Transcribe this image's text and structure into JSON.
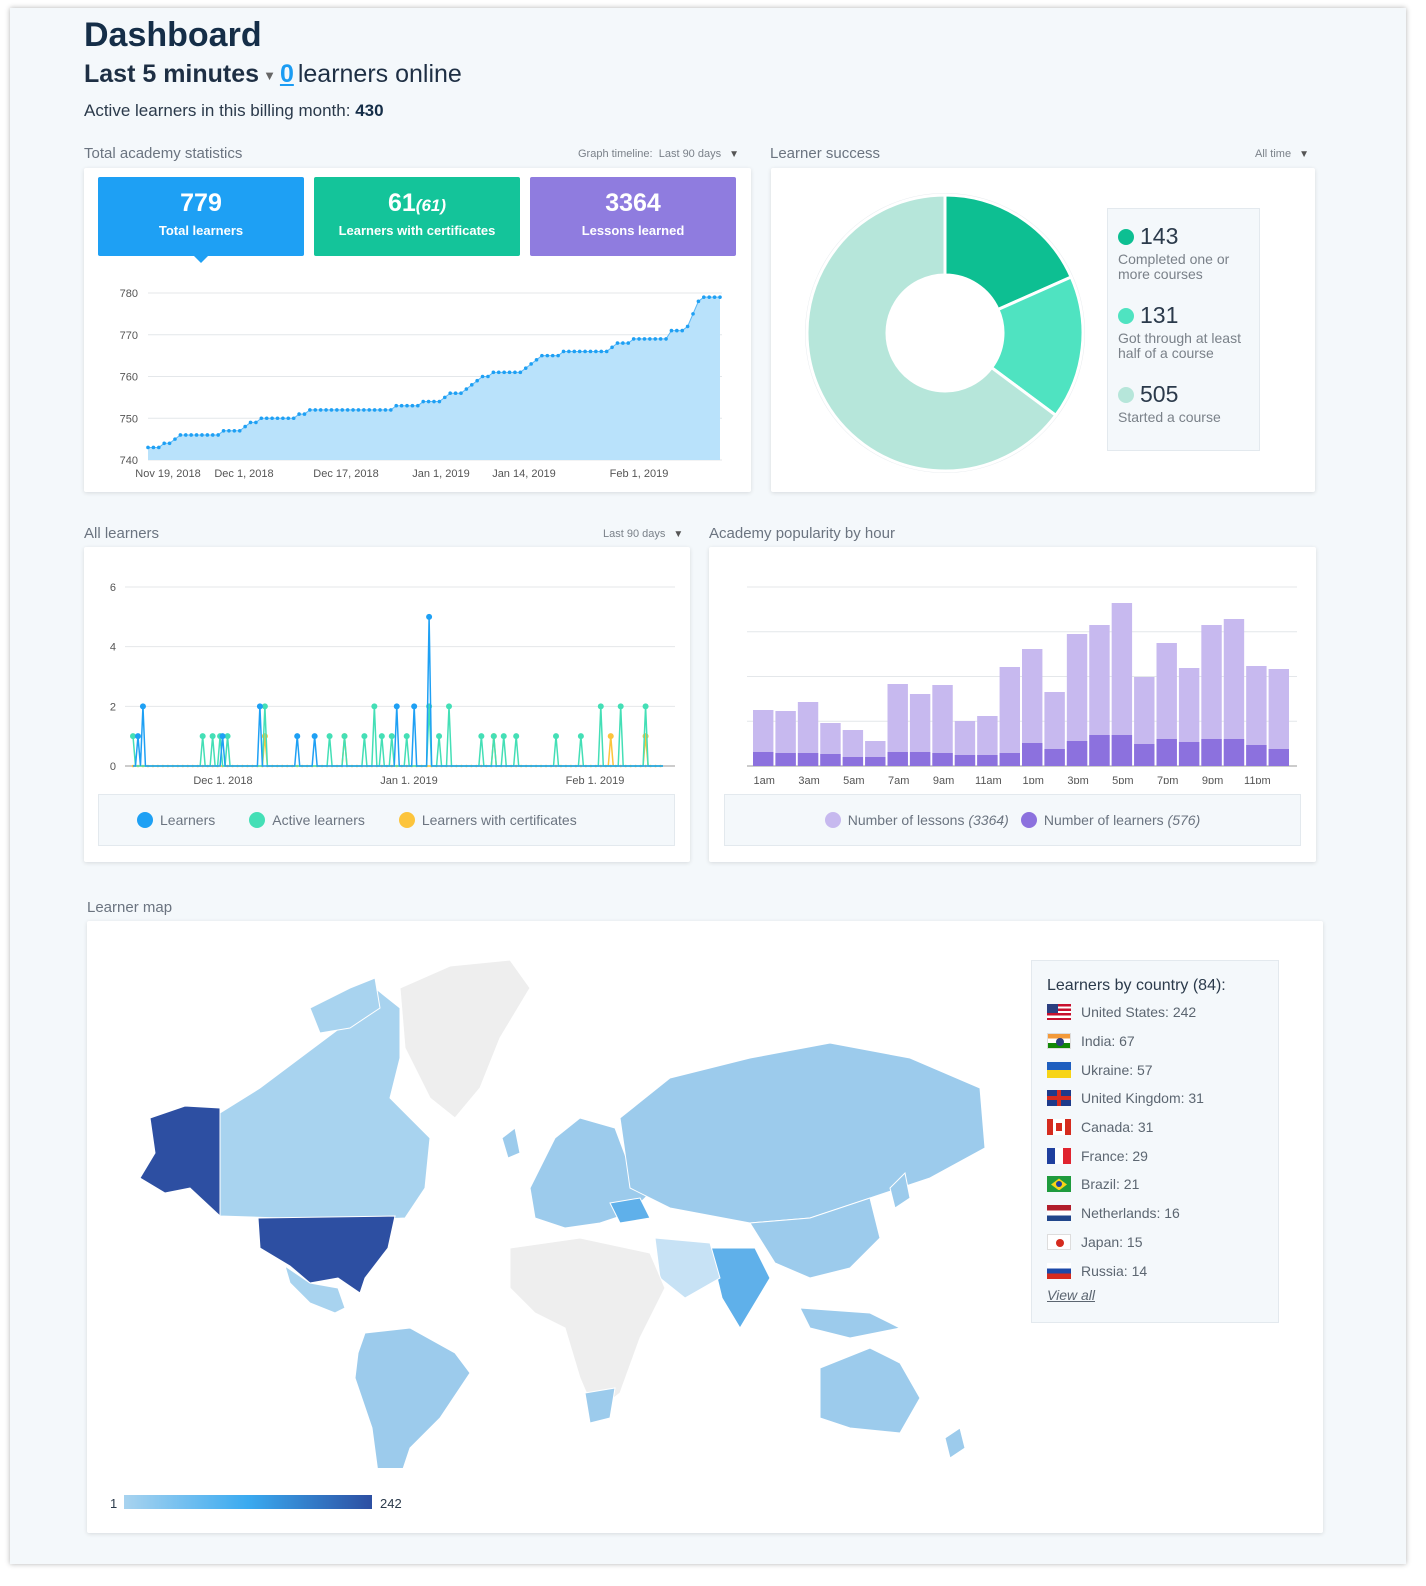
{
  "header": {
    "title": "Dashboard",
    "period_label": "Last 5 minutes",
    "online_count": "0",
    "online_suffix": "learners online",
    "billing_label": "Active learners in this billing month:",
    "billing_value": "430"
  },
  "stats": {
    "section_label": "Total academy statistics",
    "timeline_label": "Graph timeline:",
    "timeline_value": "Last 90 days",
    "total_learners": {
      "value": "779",
      "label": "Total learners",
      "color": "#1ea0f4"
    },
    "certificates": {
      "value": "61",
      "value_paren": "(61)",
      "label": "Learners with certificates",
      "color": "#14c49a"
    },
    "lessons": {
      "value": "3364",
      "label": "Lessons learned",
      "color": "#8f7cdf"
    }
  },
  "success": {
    "section_label": "Learner success",
    "filter": "All time",
    "items": [
      {
        "value": "143",
        "label": "Completed one or more courses",
        "color": "#0dbf92"
      },
      {
        "value": "131",
        "label": "Got through at least half of a course",
        "color": "#4fe3c1"
      },
      {
        "value": "505",
        "label": "Started a course",
        "color": "#b6e6da"
      }
    ]
  },
  "all_learners": {
    "section_label": "All learners",
    "filter": "Last 90 days",
    "legend": [
      {
        "label": "Learners",
        "color": "#1ea0f4"
      },
      {
        "label": "Active learners",
        "color": "#44dfb6"
      },
      {
        "label": "Learners with certificates",
        "color": "#fcc43c"
      }
    ]
  },
  "popularity": {
    "section_label": "Academy popularity by hour",
    "legend": {
      "lessons_label": "Number of lessons",
      "lessons_total": "(3364)",
      "learners_label": "Number of learners",
      "learners_total": "(576)",
      "lessons_color": "#c7b9ef",
      "learners_color": "#8c71de"
    }
  },
  "map": {
    "section_label": "Learner map",
    "scale_min": "1",
    "scale_max": "242",
    "country_title": "Learners by country (84):",
    "countries": [
      {
        "name": "United States: 242",
        "flag": "us-flag-icon"
      },
      {
        "name": "India: 67",
        "flag": "in-flag-icon"
      },
      {
        "name": "Ukraine: 57",
        "flag": "ua-flag-icon"
      },
      {
        "name": "United Kingdom: 31",
        "flag": "gb-flag-icon"
      },
      {
        "name": "Canada: 31",
        "flag": "ca-flag-icon"
      },
      {
        "name": "France: 29",
        "flag": "fr-flag-icon"
      },
      {
        "name": "Brazil: 21",
        "flag": "br-flag-icon"
      },
      {
        "name": "Netherlands: 16",
        "flag": "nl-flag-icon"
      },
      {
        "name": "Japan: 15",
        "flag": "jp-flag-icon"
      },
      {
        "name": "Russia: 14",
        "flag": "ru-flag-icon"
      }
    ],
    "view_all": "View all"
  },
  "chart_data": [
    {
      "type": "area",
      "title": "Total learners",
      "x": [
        "Nov 19, 2018",
        "Dec 1, 2018",
        "Dec 17, 2018",
        "Jan 1, 2019",
        "Jan 14, 2019",
        "Feb 1, 2019"
      ],
      "yticks": [
        "740",
        "750",
        "760",
        "770",
        "780"
      ],
      "ylim": [
        740,
        780
      ],
      "values": [
        743,
        743,
        743,
        744,
        744,
        745,
        746,
        746,
        746,
        746,
        746,
        746,
        746,
        746,
        747,
        747,
        747,
        747,
        748,
        749,
        749,
        750,
        750,
        750,
        750,
        750,
        750,
        750,
        751,
        751,
        752,
        752,
        752,
        752,
        752,
        752,
        752,
        752,
        752,
        752,
        752,
        752,
        752,
        752,
        752,
        752,
        753,
        753,
        753,
        753,
        753,
        754,
        754,
        754,
        754,
        755,
        756,
        756,
        756,
        757,
        758,
        759,
        760,
        760,
        761,
        761,
        761,
        761,
        761,
        761,
        762,
        763,
        764,
        765,
        765,
        765,
        765,
        766,
        766,
        766,
        766,
        766,
        766,
        766,
        766,
        766,
        767,
        768,
        768,
        768,
        769,
        769,
        769,
        769,
        769,
        769,
        769,
        771,
        771,
        771,
        772,
        775,
        778,
        779,
        779,
        779,
        779
      ]
    },
    {
      "type": "line",
      "title": "All learners",
      "x": [
        "Dec 1, 2018",
        "Jan 1, 2019",
        "Feb 1, 2019"
      ],
      "yticks": [
        "0",
        "2",
        "4",
        "6"
      ],
      "ylim": [
        0,
        6
      ],
      "series": [
        {
          "name": "Learners",
          "peaks": [
            [
              2,
              1
            ],
            [
              4,
              2
            ],
            [
              36,
              1
            ],
            [
              51,
              2
            ],
            [
              66,
              1
            ],
            [
              73,
              1
            ],
            [
              106,
              2
            ],
            [
              113,
              2
            ],
            [
              119,
              5
            ]
          ]
        },
        {
          "name": "Active learners",
          "peaks": [
            [
              0,
              1
            ],
            [
              28,
              1
            ],
            [
              32,
              1
            ],
            [
              35,
              1
            ],
            [
              38,
              1
            ],
            [
              53,
              2
            ],
            [
              79,
              1
            ],
            [
              85,
              1
            ],
            [
              93,
              1
            ],
            [
              97,
              2
            ],
            [
              100,
              1
            ],
            [
              104,
              1
            ],
            [
              110,
              1
            ],
            [
              119,
              2
            ],
            [
              123,
              1
            ],
            [
              127,
              2
            ],
            [
              140,
              1
            ],
            [
              145,
              1
            ],
            [
              149,
              1
            ],
            [
              154,
              1
            ],
            [
              170,
              1
            ],
            [
              180,
              1
            ],
            [
              188,
              2
            ],
            [
              196,
              2
            ],
            [
              206,
              2
            ]
          ]
        },
        {
          "name": "Learners with certificates",
          "peaks": [
            [
              53,
              1
            ],
            [
              85,
              1
            ],
            [
              145,
              1
            ],
            [
              192,
              1
            ],
            [
              206,
              1
            ]
          ]
        }
      ]
    },
    {
      "type": "bar",
      "title": "Academy popularity by hour",
      "categories": [
        "1am",
        "2am",
        "3am",
        "4am",
        "5am",
        "6am",
        "7am",
        "8am",
        "9am",
        "10am",
        "11am",
        "12pm",
        "1pm",
        "2pm",
        "3pm",
        "4pm",
        "5pm",
        "6pm",
        "7pm",
        "8pm",
        "9pm",
        "10pm",
        "11pm",
        "12am"
      ],
      "x_labels": [
        "1am",
        "3am",
        "5am",
        "7am",
        "9am",
        "11am",
        "1pm",
        "3pm",
        "5pm",
        "7pm",
        "9pm",
        "11pm"
      ],
      "series": [
        {
          "name": "Number of lessons",
          "values": [
            112,
            110,
            128,
            86,
            72,
            50,
            164,
            144,
            162,
            90,
            100,
            198,
            234,
            148,
            264,
            282,
            326,
            178,
            246,
            196,
            282,
            294,
            200,
            194
          ]
        },
        {
          "name": "Number of learners",
          "values": [
            28,
            26,
            26,
            24,
            18,
            18,
            28,
            28,
            26,
            22,
            22,
            26,
            46,
            34,
            50,
            62,
            62,
            44,
            54,
            48,
            54,
            54,
            42,
            34
          ]
        }
      ]
    }
  ]
}
